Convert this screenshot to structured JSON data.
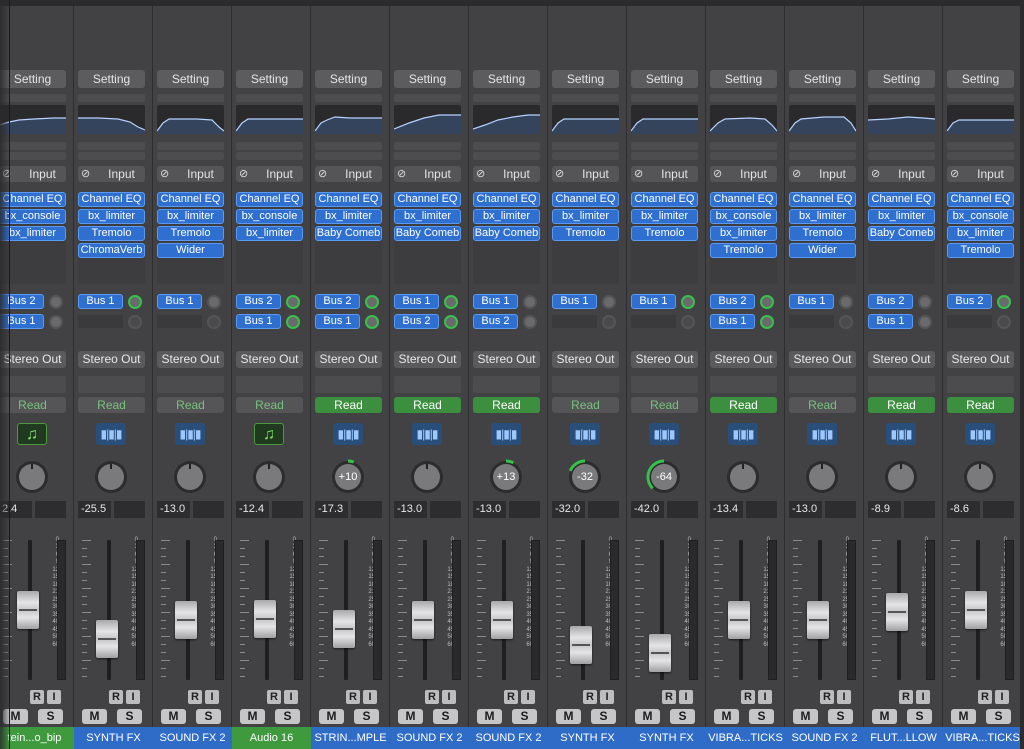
{
  "colors": {
    "plugin_blue": "#2e6fd0",
    "track_blue": "#2f6cc7",
    "track_green": "#3e9a3c",
    "automation_green": "#3b8f3f",
    "pan_arc_green": "#35c14a"
  },
  "scale_labels": [
    "0",
    "3",
    "6",
    "9",
    "12",
    "15",
    "18",
    "21",
    "25",
    "30",
    "35",
    "40",
    "45",
    "50",
    "60"
  ],
  "strips": [
    {
      "setting": "Setting",
      "input": "Input",
      "plugins": [
        "Channel EQ",
        "bx_console",
        "bx_limiter"
      ],
      "sends": [
        {
          "bus": "Bus 2",
          "knob": "grey"
        },
        {
          "bus": "Bus 1",
          "knob": "grey"
        }
      ],
      "output": "Stereo Out",
      "automation": "Read",
      "auto_on": false,
      "icon": "music",
      "pan": "",
      "pan_value": 0,
      "volume": "2.4",
      "fader": 0.5,
      "r": "R",
      "i": "I",
      "m": "M",
      "s": "S",
      "name": "tein...o_bip",
      "name_color": "green"
    },
    {
      "setting": "Setting",
      "input": "Input",
      "plugins": [
        "Channel EQ",
        "bx_limiter",
        "Tremolo",
        "ChromaVerb"
      ],
      "sends": [
        {
          "bus": "Bus 1",
          "knob": "green"
        }
      ],
      "output": "Stereo Out",
      "automation": "Read",
      "auto_on": false,
      "icon": "audio",
      "pan": "",
      "pan_value": 0,
      "volume": "-25.5",
      "fader": 0.78,
      "r": "R",
      "i": "I",
      "m": "M",
      "s": "S",
      "name": "SYNTH FX",
      "name_color": "blue"
    },
    {
      "setting": "Setting",
      "input": "Input",
      "plugins": [
        "Channel EQ",
        "bx_limiter",
        "Tremolo",
        "Wider"
      ],
      "sends": [
        {
          "bus": "Bus 1",
          "knob": "grey"
        }
      ],
      "output": "Stereo Out",
      "automation": "Read",
      "auto_on": false,
      "icon": "audio",
      "pan": "",
      "pan_value": 0,
      "volume": "-13.0",
      "fader": 0.6,
      "r": "R",
      "i": "I",
      "m": "M",
      "s": "S",
      "name": "SOUND FX 2",
      "name_color": "blue"
    },
    {
      "setting": "Setting",
      "input": "Input",
      "plugins": [
        "Channel EQ",
        "bx_console",
        "bx_limiter"
      ],
      "sends": [
        {
          "bus": "Bus 2",
          "knob": "green"
        },
        {
          "bus": "Bus 1",
          "knob": "green"
        }
      ],
      "output": "Stereo Out",
      "automation": "Read",
      "auto_on": false,
      "icon": "music",
      "pan": "",
      "pan_value": 0,
      "volume": "-12.4",
      "fader": 0.59,
      "r": "R",
      "i": "I",
      "m": "M",
      "s": "S",
      "name": "Audio 16",
      "name_color": "green"
    },
    {
      "setting": "Setting",
      "input": "Input",
      "plugins": [
        "Channel EQ",
        "bx_limiter",
        "Baby Comeb"
      ],
      "sends": [
        {
          "bus": "Bus 2",
          "knob": "green"
        },
        {
          "bus": "Bus 1",
          "knob": "green"
        }
      ],
      "output": "Stereo Out",
      "automation": "Read",
      "auto_on": true,
      "icon": "audio",
      "pan": "+10",
      "pan_value": 10,
      "volume": "-17.3",
      "fader": 0.69,
      "r": "R",
      "i": "I",
      "m": "M",
      "s": "S",
      "name": "STRIN...MPLE",
      "name_color": "blue"
    },
    {
      "setting": "Setting",
      "input": "Input",
      "plugins": [
        "Channel EQ",
        "bx_limiter",
        "Baby Comeb"
      ],
      "sends": [
        {
          "bus": "Bus 1",
          "knob": "green"
        },
        {
          "bus": "Bus 2",
          "knob": "green"
        }
      ],
      "output": "Stereo Out",
      "automation": "Read",
      "auto_on": true,
      "icon": "audio",
      "pan": "",
      "pan_value": 0,
      "volume": "-13.0",
      "fader": 0.6,
      "r": "R",
      "i": "I",
      "m": "M",
      "s": "S",
      "name": "SOUND FX 2",
      "name_color": "blue"
    },
    {
      "setting": "Setting",
      "input": "Input",
      "plugins": [
        "Channel EQ",
        "bx_limiter",
        "Baby Comeb"
      ],
      "sends": [
        {
          "bus": "Bus 1",
          "knob": "grey"
        },
        {
          "bus": "Bus 2",
          "knob": "grey"
        }
      ],
      "output": "Stereo Out",
      "automation": "Read",
      "auto_on": true,
      "icon": "audio",
      "pan": "+13",
      "pan_value": 13,
      "volume": "-13.0",
      "fader": 0.6,
      "r": "R",
      "i": "I",
      "m": "M",
      "s": "S",
      "name": "SOUND FX 2",
      "name_color": "blue"
    },
    {
      "setting": "Setting",
      "input": "Input",
      "plugins": [
        "Channel EQ",
        "bx_limiter",
        "Tremolo"
      ],
      "sends": [
        {
          "bus": "Bus 1",
          "knob": "grey"
        }
      ],
      "output": "Stereo Out",
      "automation": "Read",
      "auto_on": false,
      "icon": "audio",
      "pan": "-32",
      "pan_value": -32,
      "volume": "-32.0",
      "fader": 0.84,
      "r": "R",
      "i": "I",
      "m": "M",
      "s": "S",
      "name": "SYNTH FX",
      "name_color": "blue"
    },
    {
      "setting": "Setting",
      "input": "Input",
      "plugins": [
        "Channel EQ",
        "bx_limiter",
        "Tremolo"
      ],
      "sends": [
        {
          "bus": "Bus 1",
          "knob": "green"
        }
      ],
      "output": "Stereo Out",
      "automation": "Read",
      "auto_on": false,
      "icon": "audio",
      "pan": "-64",
      "pan_value": -64,
      "volume": "-42.0",
      "fader": 0.92,
      "r": "R",
      "i": "I",
      "m": "M",
      "s": "S",
      "name": "SYNTH FX",
      "name_color": "blue"
    },
    {
      "setting": "Setting",
      "input": "Input",
      "plugins": [
        "Channel EQ",
        "bx_console",
        "bx_limiter",
        "Tremolo"
      ],
      "sends": [
        {
          "bus": "Bus 2",
          "knob": "green"
        },
        {
          "bus": "Bus 1",
          "knob": "green"
        }
      ],
      "output": "Stereo Out",
      "automation": "Read",
      "auto_on": true,
      "icon": "audio",
      "pan": "",
      "pan_value": 0,
      "volume": "-13.4",
      "fader": 0.6,
      "r": "R",
      "i": "I",
      "m": "M",
      "s": "S",
      "name": "VIBRA...TICKS",
      "name_color": "blue"
    },
    {
      "setting": "Setting",
      "input": "Input",
      "plugins": [
        "Channel EQ",
        "bx_limiter",
        "Tremolo",
        "Wider"
      ],
      "sends": [
        {
          "bus": "Bus 1",
          "knob": "grey"
        }
      ],
      "output": "Stereo Out",
      "automation": "Read",
      "auto_on": false,
      "icon": "audio",
      "pan": "",
      "pan_value": 0,
      "volume": "-13.0",
      "fader": 0.6,
      "r": "R",
      "i": "I",
      "m": "M",
      "s": "S",
      "name": "SOUND FX 2",
      "name_color": "blue"
    },
    {
      "setting": "Setting",
      "input": "Input",
      "plugins": [
        "Channel EQ",
        "bx_limiter",
        "Baby Comeb"
      ],
      "sends": [
        {
          "bus": "Bus 2",
          "knob": "grey"
        },
        {
          "bus": "Bus 1",
          "knob": "grey"
        }
      ],
      "output": "Stereo Out",
      "automation": "Read",
      "auto_on": true,
      "icon": "audio",
      "pan": "",
      "pan_value": 0,
      "volume": "-8.9",
      "fader": 0.52,
      "r": "R",
      "i": "I",
      "m": "M",
      "s": "S",
      "name": "FLUT...LLOW",
      "name_color": "blue"
    },
    {
      "setting": "Setting",
      "input": "Input",
      "plugins": [
        "Channel EQ",
        "bx_console",
        "bx_limiter",
        "Tremolo"
      ],
      "sends": [
        {
          "bus": "Bus 2",
          "knob": "green"
        }
      ],
      "output": "Stereo Out",
      "automation": "Read",
      "auto_on": true,
      "icon": "audio",
      "pan": "",
      "pan_value": 0,
      "volume": "-8.6",
      "fader": 0.5,
      "r": "R",
      "i": "I",
      "m": "M",
      "s": "S",
      "name": "VIBRA...TICKS",
      "name_color": "blue"
    }
  ]
}
